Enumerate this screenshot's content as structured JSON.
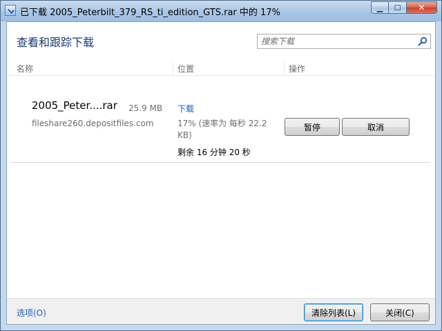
{
  "window": {
    "title": "已下载 2005_Peterbilt_379_RS_ti_edition_GTS.rar 中的 17%",
    "minimize_glyph": "▁",
    "maximize_glyph": "☐",
    "close_glyph": "✕"
  },
  "header": {
    "title": "查看和跟踪下载",
    "search_placeholder": "搜索下载"
  },
  "columns": [
    {
      "label": "名称"
    },
    {
      "label": "位置"
    },
    {
      "label": "操作"
    }
  ],
  "download": {
    "file_name": "2005_Peter....rar",
    "file_size": "25.9 MB",
    "source": "fileshare260.depositfiles.com",
    "location_link": "下载",
    "progress_text": "17% (速率为 每秒 22.2 KB)",
    "progress_percent": 17,
    "remaining": "剩余  16 分钟 20 秒",
    "pause_label": "暂停",
    "cancel_label": "取消"
  },
  "footer": {
    "options_label": "选项(O)",
    "clear_list_label": "清除列表(L)",
    "close_label": "关闭(C)"
  },
  "colors": {
    "heading": "#1d3a72",
    "link": "#1a5cb0",
    "muted_text": "#6d6d6d"
  }
}
